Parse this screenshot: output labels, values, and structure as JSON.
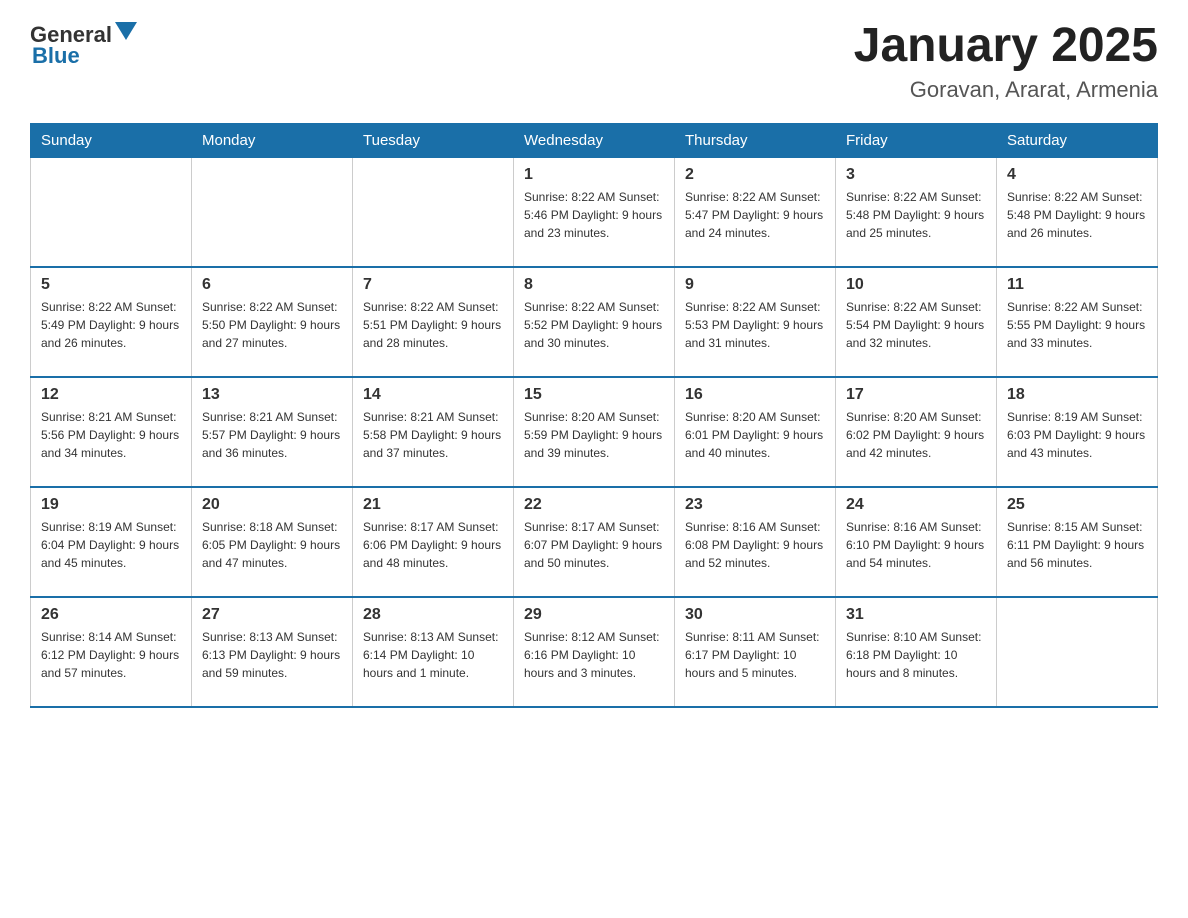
{
  "header": {
    "logo_general": "General",
    "logo_blue": "Blue",
    "title": "January 2025",
    "subtitle": "Goravan, Ararat, Armenia"
  },
  "days_of_week": [
    "Sunday",
    "Monday",
    "Tuesday",
    "Wednesday",
    "Thursday",
    "Friday",
    "Saturday"
  ],
  "weeks": [
    [
      {
        "day": "",
        "info": ""
      },
      {
        "day": "",
        "info": ""
      },
      {
        "day": "",
        "info": ""
      },
      {
        "day": "1",
        "info": "Sunrise: 8:22 AM\nSunset: 5:46 PM\nDaylight: 9 hours and 23 minutes."
      },
      {
        "day": "2",
        "info": "Sunrise: 8:22 AM\nSunset: 5:47 PM\nDaylight: 9 hours and 24 minutes."
      },
      {
        "day": "3",
        "info": "Sunrise: 8:22 AM\nSunset: 5:48 PM\nDaylight: 9 hours and 25 minutes."
      },
      {
        "day": "4",
        "info": "Sunrise: 8:22 AM\nSunset: 5:48 PM\nDaylight: 9 hours and 26 minutes."
      }
    ],
    [
      {
        "day": "5",
        "info": "Sunrise: 8:22 AM\nSunset: 5:49 PM\nDaylight: 9 hours and 26 minutes."
      },
      {
        "day": "6",
        "info": "Sunrise: 8:22 AM\nSunset: 5:50 PM\nDaylight: 9 hours and 27 minutes."
      },
      {
        "day": "7",
        "info": "Sunrise: 8:22 AM\nSunset: 5:51 PM\nDaylight: 9 hours and 28 minutes."
      },
      {
        "day": "8",
        "info": "Sunrise: 8:22 AM\nSunset: 5:52 PM\nDaylight: 9 hours and 30 minutes."
      },
      {
        "day": "9",
        "info": "Sunrise: 8:22 AM\nSunset: 5:53 PM\nDaylight: 9 hours and 31 minutes."
      },
      {
        "day": "10",
        "info": "Sunrise: 8:22 AM\nSunset: 5:54 PM\nDaylight: 9 hours and 32 minutes."
      },
      {
        "day": "11",
        "info": "Sunrise: 8:22 AM\nSunset: 5:55 PM\nDaylight: 9 hours and 33 minutes."
      }
    ],
    [
      {
        "day": "12",
        "info": "Sunrise: 8:21 AM\nSunset: 5:56 PM\nDaylight: 9 hours and 34 minutes."
      },
      {
        "day": "13",
        "info": "Sunrise: 8:21 AM\nSunset: 5:57 PM\nDaylight: 9 hours and 36 minutes."
      },
      {
        "day": "14",
        "info": "Sunrise: 8:21 AM\nSunset: 5:58 PM\nDaylight: 9 hours and 37 minutes."
      },
      {
        "day": "15",
        "info": "Sunrise: 8:20 AM\nSunset: 5:59 PM\nDaylight: 9 hours and 39 minutes."
      },
      {
        "day": "16",
        "info": "Sunrise: 8:20 AM\nSunset: 6:01 PM\nDaylight: 9 hours and 40 minutes."
      },
      {
        "day": "17",
        "info": "Sunrise: 8:20 AM\nSunset: 6:02 PM\nDaylight: 9 hours and 42 minutes."
      },
      {
        "day": "18",
        "info": "Sunrise: 8:19 AM\nSunset: 6:03 PM\nDaylight: 9 hours and 43 minutes."
      }
    ],
    [
      {
        "day": "19",
        "info": "Sunrise: 8:19 AM\nSunset: 6:04 PM\nDaylight: 9 hours and 45 minutes."
      },
      {
        "day": "20",
        "info": "Sunrise: 8:18 AM\nSunset: 6:05 PM\nDaylight: 9 hours and 47 minutes."
      },
      {
        "day": "21",
        "info": "Sunrise: 8:17 AM\nSunset: 6:06 PM\nDaylight: 9 hours and 48 minutes."
      },
      {
        "day": "22",
        "info": "Sunrise: 8:17 AM\nSunset: 6:07 PM\nDaylight: 9 hours and 50 minutes."
      },
      {
        "day": "23",
        "info": "Sunrise: 8:16 AM\nSunset: 6:08 PM\nDaylight: 9 hours and 52 minutes."
      },
      {
        "day": "24",
        "info": "Sunrise: 8:16 AM\nSunset: 6:10 PM\nDaylight: 9 hours and 54 minutes."
      },
      {
        "day": "25",
        "info": "Sunrise: 8:15 AM\nSunset: 6:11 PM\nDaylight: 9 hours and 56 minutes."
      }
    ],
    [
      {
        "day": "26",
        "info": "Sunrise: 8:14 AM\nSunset: 6:12 PM\nDaylight: 9 hours and 57 minutes."
      },
      {
        "day": "27",
        "info": "Sunrise: 8:13 AM\nSunset: 6:13 PM\nDaylight: 9 hours and 59 minutes."
      },
      {
        "day": "28",
        "info": "Sunrise: 8:13 AM\nSunset: 6:14 PM\nDaylight: 10 hours and 1 minute."
      },
      {
        "day": "29",
        "info": "Sunrise: 8:12 AM\nSunset: 6:16 PM\nDaylight: 10 hours and 3 minutes."
      },
      {
        "day": "30",
        "info": "Sunrise: 8:11 AM\nSunset: 6:17 PM\nDaylight: 10 hours and 5 minutes."
      },
      {
        "day": "31",
        "info": "Sunrise: 8:10 AM\nSunset: 6:18 PM\nDaylight: 10 hours and 8 minutes."
      },
      {
        "day": "",
        "info": ""
      }
    ]
  ]
}
